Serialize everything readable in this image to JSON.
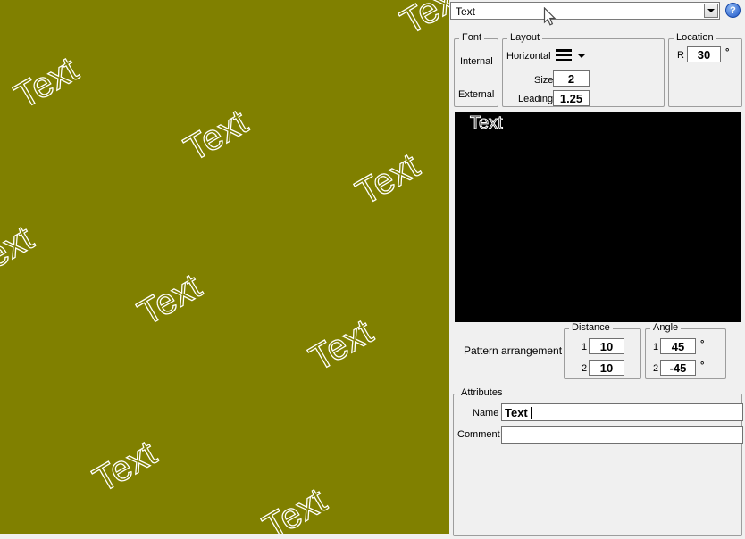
{
  "style_selector": {
    "value": "Text",
    "help_glyph": "?"
  },
  "font_group": {
    "title": "Font",
    "internal": "Internal",
    "external": "External"
  },
  "layout_group": {
    "title": "Layout",
    "horizontal_label": "Horizontal",
    "size_label": "Size",
    "size_value": "2",
    "leading_label": "Leading",
    "leading_value": "1.25"
  },
  "location_group": {
    "title": "Location",
    "r_label": "R",
    "r_value": "30",
    "unit": "°"
  },
  "text_preview": {
    "sample": "Text"
  },
  "pattern_preview": {
    "text": "Text",
    "background_color": "#808000"
  },
  "arrangement": {
    "label": "Pattern arrangement",
    "distance": {
      "title": "Distance",
      "row1_index": "1",
      "row1_value": "10",
      "row2_index": "2",
      "row2_value": "10"
    },
    "angle": {
      "title": "Angle",
      "row1_index": "1",
      "row1_value": "45",
      "row1_unit": "°",
      "row2_index": "2",
      "row2_value": "-45",
      "row2_unit": "°"
    }
  },
  "attributes": {
    "title": "Attributes",
    "name_label": "Name",
    "name_value": "Text",
    "comment_label": "Comment",
    "comment_value": ""
  }
}
